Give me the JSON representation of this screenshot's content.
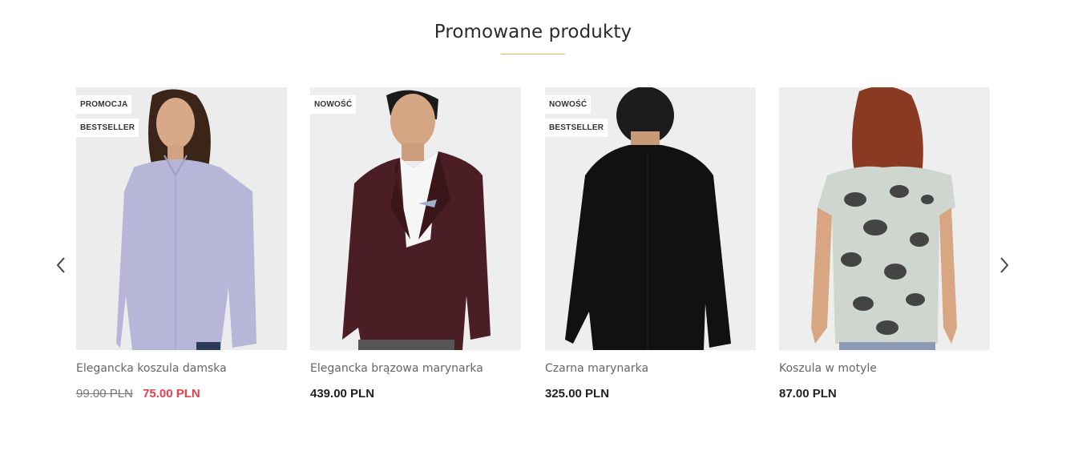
{
  "section": {
    "title": "Promowane produkty",
    "accent_color": "#d8b56a"
  },
  "carousel": {
    "prev_icon": "chevron-left-icon",
    "next_icon": "chevron-right-icon"
  },
  "products": [
    {
      "name": "Elegancka koszula damska",
      "badges": [
        "PROMOCJA",
        "BESTSELLER"
      ],
      "price_old": "99.00 PLN",
      "price": "75.00 PLN",
      "on_sale": true
    },
    {
      "name": "Elegancka brązowa marynarka",
      "badges": [
        "NOWOŚĆ"
      ],
      "price": "439.00 PLN",
      "on_sale": false
    },
    {
      "name": "Czarna marynarka",
      "badges": [
        "NOWOŚĆ",
        "BESTSELLER"
      ],
      "price": "325.00 PLN",
      "on_sale": false
    },
    {
      "name": "Koszula w motyle",
      "badges": [],
      "price": "87.00 PLN",
      "on_sale": false
    }
  ],
  "colors": {
    "sale_price": "#ee3d4a",
    "text": "#222222",
    "muted": "#666666"
  }
}
